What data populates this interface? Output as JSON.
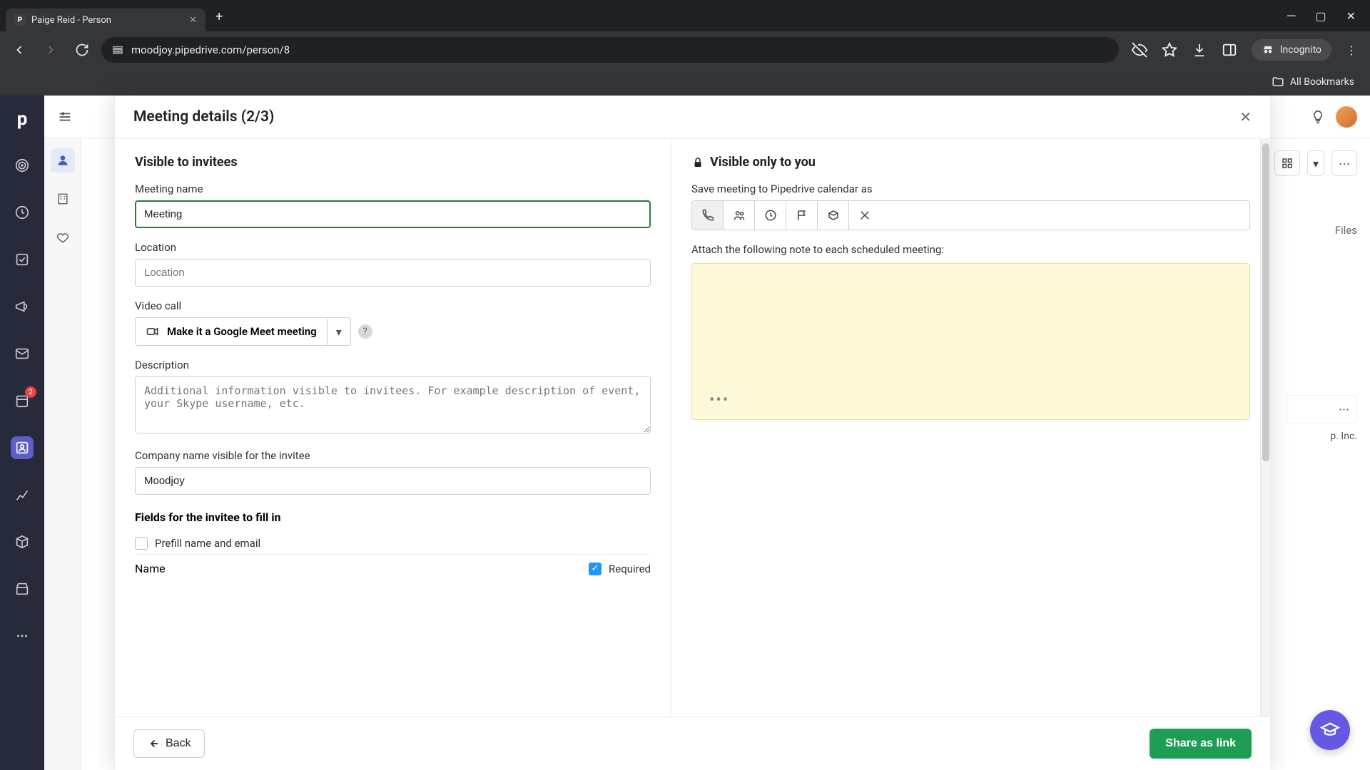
{
  "browser": {
    "tab_title": "Paige Reid - Person",
    "url": "moodjoy.pipedrive.com/person/8",
    "incognito": "Incognito",
    "all_bookmarks": "All Bookmarks"
  },
  "sidebar": {
    "badge_count": "2"
  },
  "modal": {
    "title": "Meeting details (2/3)",
    "left": {
      "section_title": "Visible to invitees",
      "meeting_name_label": "Meeting name",
      "meeting_name_value": "Meeting",
      "location_label": "Location",
      "location_placeholder": "Location",
      "video_label": "Video call",
      "video_button": "Make it a Google Meet meeting",
      "description_label": "Description",
      "description_placeholder": "Additional information visible to invitees. For example description of event, your Skype username, etc.",
      "company_label": "Company name visible for the invitee",
      "company_value": "Moodjoy",
      "fields_title": "Fields for the invitee to fill in",
      "prefill_label": "Prefill name and email",
      "name_label": "Name",
      "required_label": "Required"
    },
    "right": {
      "section_title": "Visible only to you",
      "save_label": "Save meeting to Pipedrive calendar as",
      "note_label": "Attach the following note to each scheduled meeting:"
    },
    "footer": {
      "back": "Back",
      "share": "Share as link"
    }
  },
  "bg": {
    "files": "Files",
    "ip_inc": "p. Inc."
  }
}
